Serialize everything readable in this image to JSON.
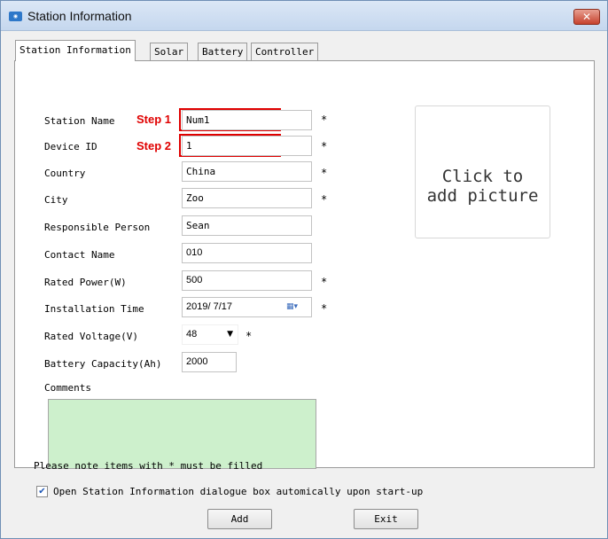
{
  "window": {
    "title": "Station Information",
    "close_label": "✕",
    "app_icon": "app-icon"
  },
  "tabs": [
    {
      "label": "Station Information",
      "active": true
    },
    {
      "label": "Solar",
      "active": false
    },
    {
      "label": "Battery",
      "active": false
    },
    {
      "label": "Controller",
      "active": false
    }
  ],
  "form": {
    "station_name": {
      "label": "Station Name",
      "value": "Num1",
      "required": "*"
    },
    "device_id": {
      "label": "Device ID",
      "value": "1",
      "required": "*"
    },
    "country": {
      "label": "Country",
      "value": "China",
      "required": "*"
    },
    "city": {
      "label": "City",
      "value": "Zoo",
      "required": "*"
    },
    "responsible_person": {
      "label": "Responsible Person",
      "value": "Sean"
    },
    "contact_name": {
      "label": "Contact Name",
      "value": "010"
    },
    "rated_power": {
      "label": "Rated Power(W)",
      "value": "500",
      "required": "*"
    },
    "installation_time": {
      "label": "Installation Time",
      "value": "2019/ 7/17",
      "required": "*"
    },
    "rated_voltage": {
      "label": "Rated Voltage(V)",
      "value": "48",
      "required": "*"
    },
    "battery_capacity": {
      "label": "Battery Capacity(Ah)",
      "value": "2000"
    },
    "comments": {
      "label": "Comments",
      "value": ""
    }
  },
  "annotations": {
    "step1": "Step 1",
    "step2": "Step 2",
    "highlight_color": "#e00000"
  },
  "picture": {
    "line1": "Click to",
    "line2": "add picture"
  },
  "footer": {
    "note": "Please note items with * must be filled",
    "autostart_label": "Open Station Information dialogue box automically upon start-up",
    "autostart_checked": true,
    "add_label": "Add",
    "exit_label": "Exit"
  },
  "colors": {
    "comments_bg": "#cdf0cc",
    "title_bar": "#c5d7ee"
  }
}
